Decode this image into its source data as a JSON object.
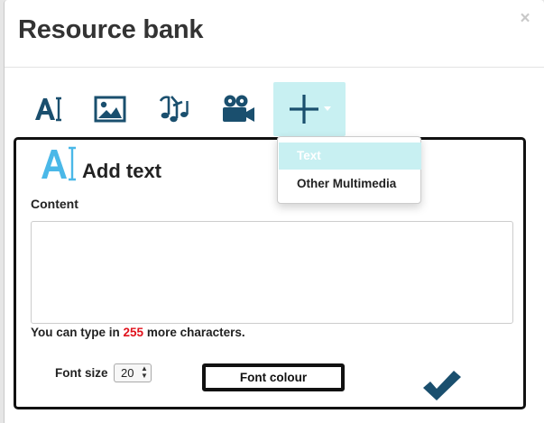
{
  "modal": {
    "title": "Resource bank",
    "close_symbol": "×"
  },
  "toolbar": {
    "buttons": [
      {
        "name": "text",
        "icon": "text-cursor-icon"
      },
      {
        "name": "image",
        "icon": "image-icon"
      },
      {
        "name": "audio",
        "icon": "music-notes-icon"
      },
      {
        "name": "video",
        "icon": "video-camera-icon"
      },
      {
        "name": "add",
        "icon": "plus-icon",
        "active": true
      }
    ],
    "active_bg": "#c8f0f2",
    "icon_color": "#1a4f6e"
  },
  "dropdown": {
    "items": [
      {
        "label": "Text",
        "active": true
      },
      {
        "label": "Other Multimedia",
        "active": false
      }
    ]
  },
  "panel": {
    "title": "Add text",
    "icon": "text-cursor-icon",
    "icon_color": "#4ab8e8",
    "content_label": "Content",
    "content_value": "",
    "char_count": {
      "prefix": "You can type in",
      "remaining": "255",
      "suffix": "more characters.",
      "remaining_color": "#e0121c"
    },
    "font_size": {
      "label": "Font size",
      "value": "20"
    },
    "font_colour_label": "Font colour",
    "confirm_icon": "checkmark-icon"
  }
}
